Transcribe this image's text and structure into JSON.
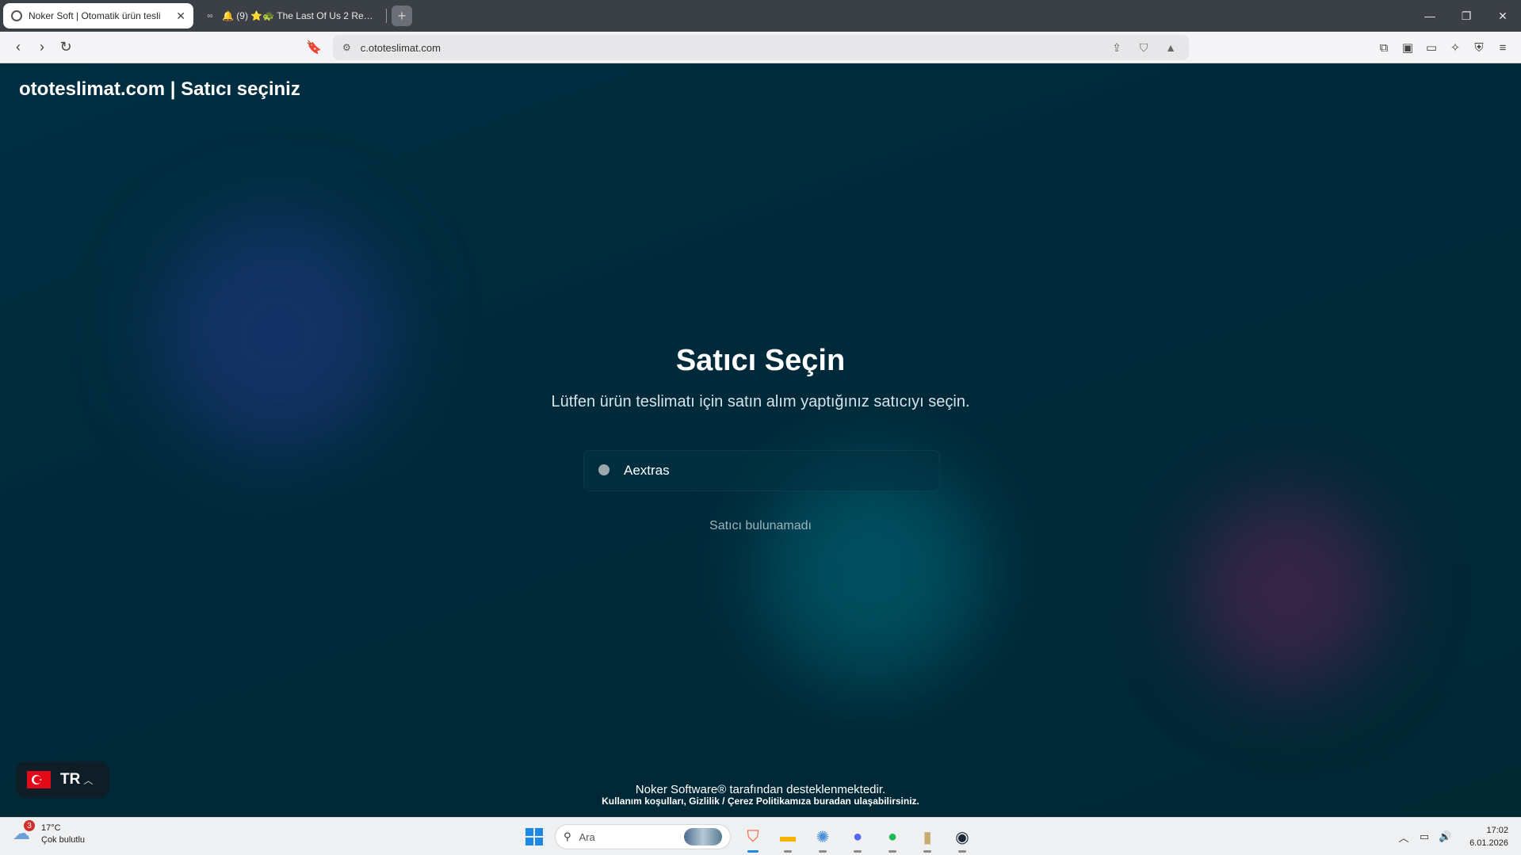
{
  "browser": {
    "tabs": [
      {
        "title": "Noker Soft | Otomatik ürün tesli",
        "active": true
      },
      {
        "title": "🔔 (9) ⭐🐢 The Last Of Us 2 Remas",
        "active": false
      }
    ],
    "url": "c.ototeslimat.com"
  },
  "page": {
    "brand": "ototeslimat.com | Satıcı seçiniz",
    "heading": "Satıcı Seçin",
    "subtitle": "Lütfen ürün teslimatı için satın alım yaptığınız satıcıyı seçin.",
    "search_value": "Aextras",
    "no_result": "Satıcı bulunamadı",
    "language_code": "TR",
    "footer_line1": "Noker Software® tarafından desteklenmektedir.",
    "footer_line2": "Kullanım koşulları, Gizlilik / Çerez Politikamıza buradan ulaşabilirsiniz."
  },
  "taskbar": {
    "weather_temp": "17°C",
    "weather_desc": "Çok bulutlu",
    "weather_badge": "3",
    "search_placeholder": "Ara",
    "time": "17:02",
    "date": "6.01.2026"
  },
  "colors": {
    "page_bg": "#002a38",
    "flag_red": "#e30a17",
    "brave_orange": "#fb542b"
  }
}
